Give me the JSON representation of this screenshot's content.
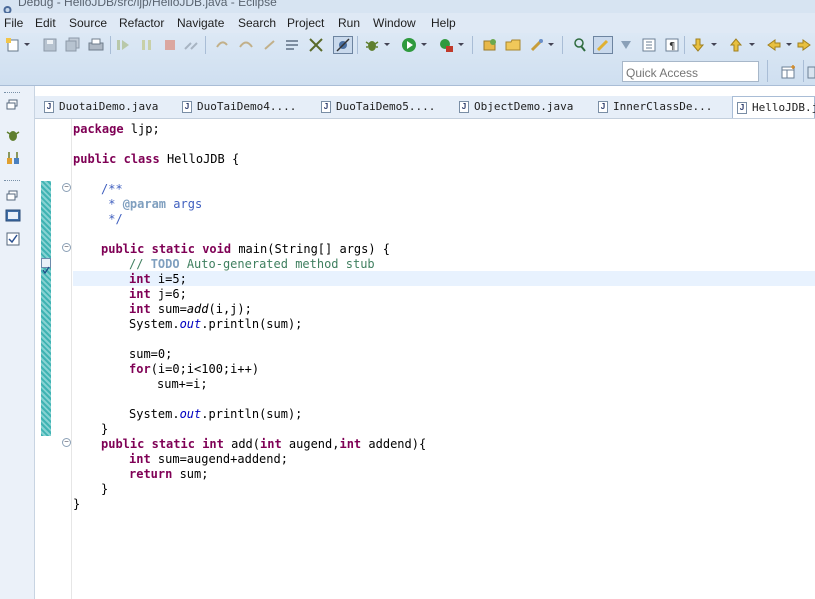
{
  "window": {
    "title": "Debug - HelloJDB/src/ljp/HelloJDB.java - Eclipse"
  },
  "menu": [
    "File",
    "Edit",
    "Source",
    "Refactor",
    "Navigate",
    "Search",
    "Project",
    "Run",
    "Window",
    "Help"
  ],
  "toolbar": {
    "quick_access_placeholder": "Quick Access",
    "icons": [
      "new-icon",
      "save-icon",
      "save-all-icon",
      "print-icon",
      "resume-icon",
      "suspend-icon",
      "terminate-icon",
      "disconnect-icon",
      "step-into-icon",
      "step-over-icon",
      "step-return-icon",
      "drop-to-frame-icon",
      "use-step-filters-icon",
      "skip-breakpoints-icon",
      "debug-icon",
      "run-icon",
      "run-external-tool-icon",
      "new-java-package-icon",
      "open-type-icon",
      "search-icon",
      "toggle-mark-occurrences-icon",
      "highlight-icon",
      "next-annotation-icon",
      "show-whitespace-icon",
      "block-selection-icon",
      "next-edit-icon",
      "previous-edit-icon",
      "back-icon",
      "forward-icon",
      "open-perspective-icon",
      "perspective-icon"
    ]
  },
  "tabs": [
    {
      "label": "DuotaiDemo.java",
      "active": false
    },
    {
      "label": "DuoTaiDemo4....",
      "active": false
    },
    {
      "label": "DuoTaiDemo5....",
      "active": false
    },
    {
      "label": "ObjectDemo.java",
      "active": false
    },
    {
      "label": "InnerClassDe...",
      "active": false
    },
    {
      "label": "HelloJDB.j",
      "active": true
    }
  ],
  "code": {
    "line1": "package ljp;",
    "line2": "public class HelloJDB {",
    "line3": "/**",
    "line4": " * @param args",
    "line5": " */",
    "line6": "public static void main(String[] args) {",
    "line7": "// TODO Auto-generated method stub",
    "line8": "int i=5;",
    "line9": "int j=6;",
    "line10": "int sum=add(i,j);",
    "line11": "System.out.println(sum);",
    "line12": "sum=0;",
    "line13": "for(i=0;i<100;i++)",
    "line14": "sum+=i;",
    "line15": "System.out.println(sum);",
    "line16": "}",
    "line17": "public static int add(int augend,int addend){",
    "line18": "int sum=augend+addend;",
    "line19": "return sum;",
    "line20": "}",
    "line21": "}",
    "tokens": {
      "kw_package": "package",
      "id_ljp": " ljp;",
      "kw_public": "public",
      "kw_class": "class",
      "id_class": " HelloJDB {",
      "jd_open": "/**",
      "jd_star": " * ",
      "jd_tag": "@param",
      "jd_args": " args",
      "jd_close": " */",
      "kw_static": "static",
      "kw_void": "void",
      "id_main": " main(String[] args) {",
      "cm_slashes": "// ",
      "cm_todo": "TODO",
      "cm_rest": " Auto-generated method stub",
      "kw_int": "int",
      "id_i5": " i=5;",
      "id_j6": " j=6;",
      "id_sum": " sum=",
      "id_add": "add",
      "id_addargs": "(i,j);",
      "id_system": "System.",
      "fld_out": "out",
      "id_println": ".println(sum);",
      "id_sum0": "sum=0;",
      "kw_for": "for",
      "id_forargs": "(i=0;i<100;i++)",
      "id_sumplus": "sum+=i;",
      "id_close": "}",
      "id_addsig": " add(",
      "id_augend": " augend,",
      "id_addend": " addend){",
      "id_sumcalc": " sum=augend+addend;",
      "kw_return": "return",
      "id_retsum": " sum;"
    }
  },
  "colors": {
    "keyword": "#7f0055",
    "comment": "#3f7f5f",
    "javadoc": "#3f5fbf",
    "field": "#0000c0",
    "current_line": "#e8f2fe"
  }
}
